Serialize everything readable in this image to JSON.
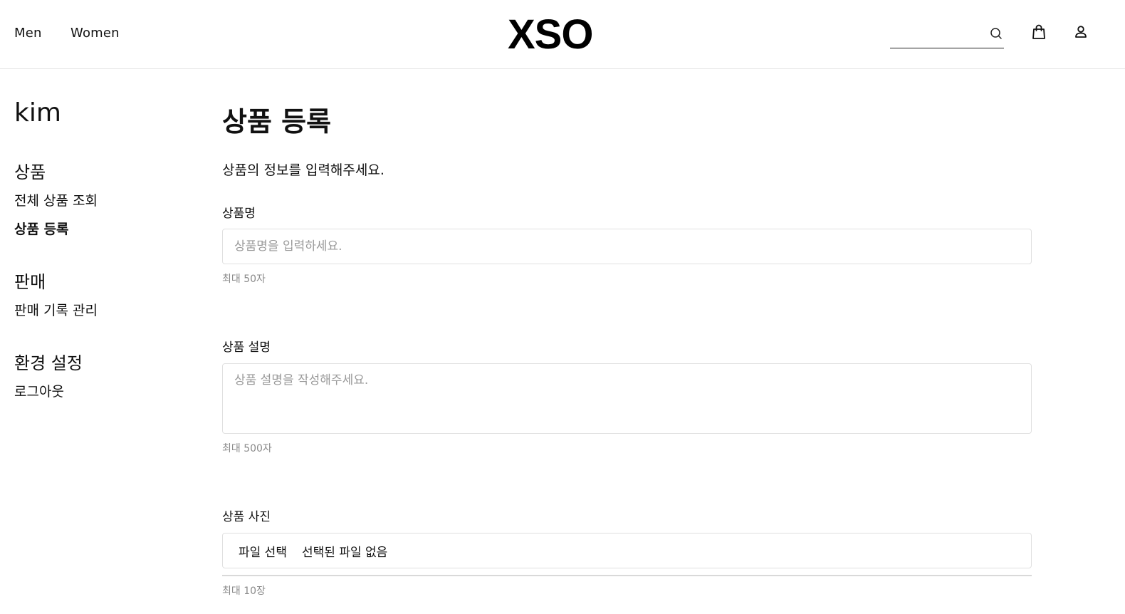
{
  "header": {
    "nav": [
      {
        "label": "Men"
      },
      {
        "label": "Women"
      }
    ],
    "logo": "XSO",
    "search": {
      "placeholder": "",
      "value": ""
    },
    "icons": {
      "search": "search-icon",
      "bag": "shopping-bag-icon",
      "user": "user-icon"
    }
  },
  "sidebar": {
    "username": "kim",
    "sections": [
      {
        "title": "상품",
        "items": [
          {
            "label": "전체 상품 조회",
            "active": false
          },
          {
            "label": "상품 등록",
            "active": true
          }
        ]
      },
      {
        "title": "판매",
        "items": [
          {
            "label": "판매 기록 관리",
            "active": false
          }
        ]
      },
      {
        "title": "환경 설정",
        "items": [
          {
            "label": "로그아웃",
            "active": false
          }
        ]
      }
    ]
  },
  "main": {
    "title": "상품 등록",
    "description": "상품의 정보를 입력해주세요.",
    "fields": {
      "name": {
        "label": "상품명",
        "placeholder": "상품명을 입력하세요.",
        "value": "",
        "hint": "최대 50자"
      },
      "description": {
        "label": "상품 설명",
        "placeholder": "상품 설명을 작성해주세요.",
        "value": "",
        "hint": "최대 500자"
      },
      "photos": {
        "label": "상품 사진",
        "button_label": "파일 선택",
        "status": "선택된 파일 없음",
        "hint": "최대 10장"
      }
    }
  },
  "colors": {
    "text": "#111111",
    "border": "#e0e0e0",
    "placeholder": "#9a9a9a",
    "hint": "#8a8a8a"
  }
}
